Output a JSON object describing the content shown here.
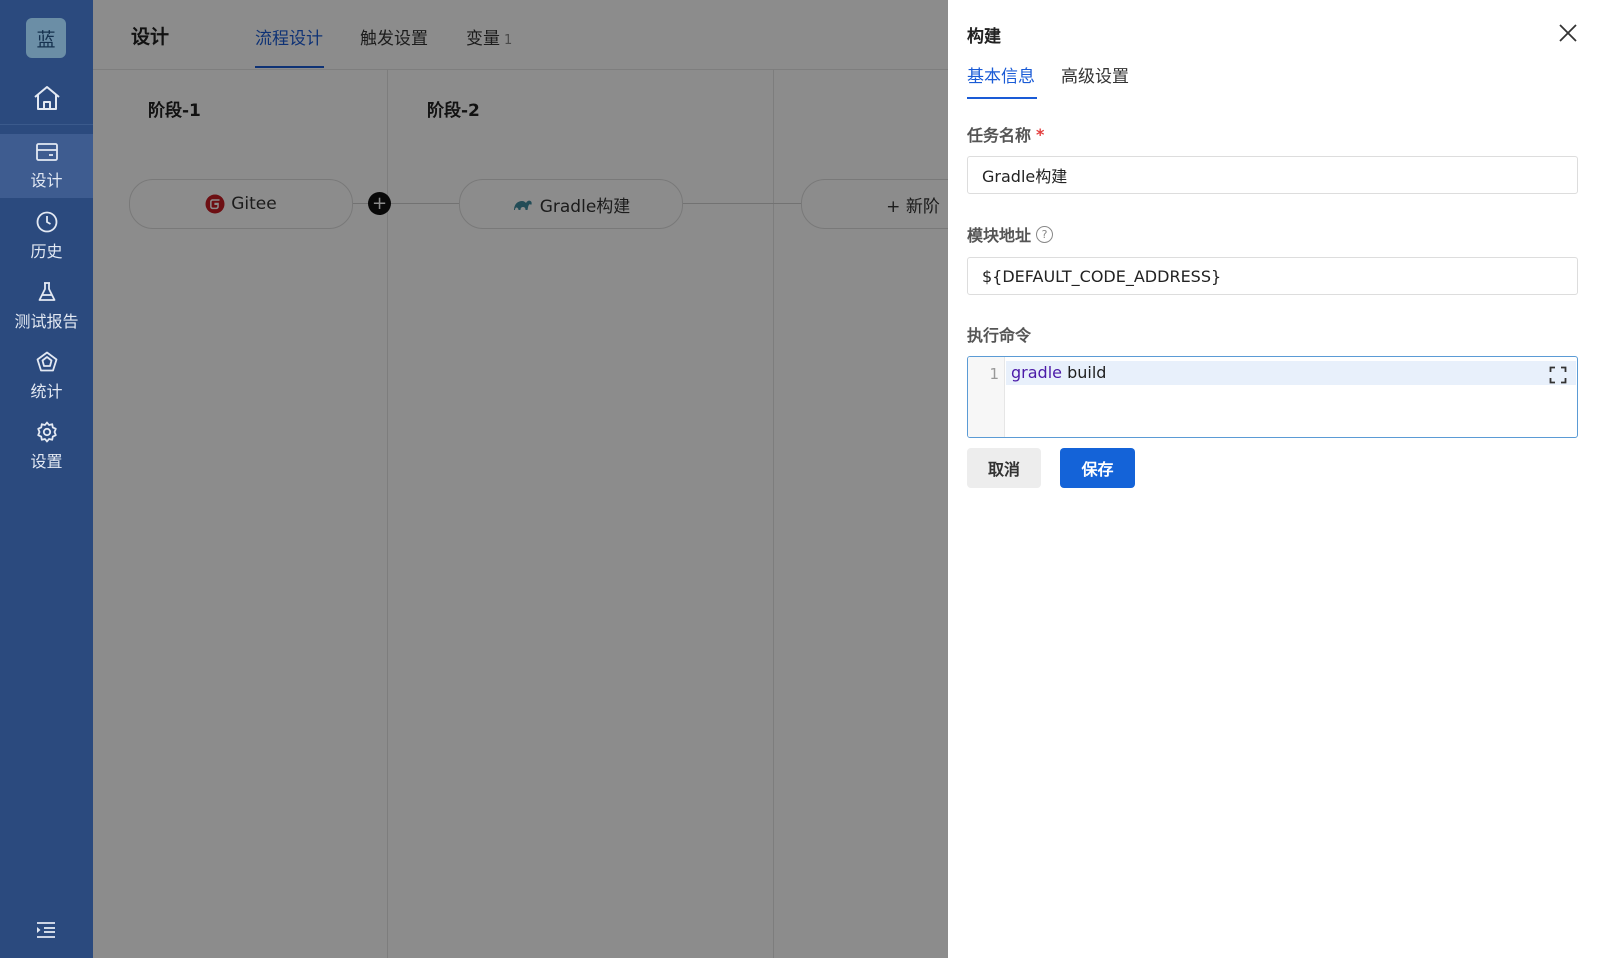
{
  "sidebar": {
    "logo_text": "蓝",
    "items": [
      {
        "label": "设计",
        "icon": "design-icon",
        "active": true
      },
      {
        "label": "历史",
        "icon": "clock-icon"
      },
      {
        "label": "测试报告",
        "icon": "flask-icon"
      },
      {
        "label": "统计",
        "icon": "pentagon-chart-icon"
      },
      {
        "label": "设置",
        "icon": "gear-icon"
      }
    ]
  },
  "header": {
    "title": "设计",
    "tabs": [
      {
        "label": "流程设计",
        "active": true
      },
      {
        "label": "触发设置"
      },
      {
        "label": "变量",
        "count": "1"
      }
    ]
  },
  "pipeline": {
    "stages": [
      {
        "title": "阶段-1",
        "node": "Gitee",
        "node_icon": "gitee-icon"
      },
      {
        "title": "阶段-2",
        "node": "Gradle构建",
        "node_icon": "gradle-icon"
      }
    ],
    "add_stage_label": "+ 新阶"
  },
  "drawer": {
    "title": "构建",
    "tabs": [
      {
        "label": "基本信息",
        "active": true
      },
      {
        "label": "高级设置"
      }
    ],
    "fields": {
      "task_name": {
        "label": "任务名称",
        "required_mark": "*",
        "value": "Gradle构建"
      },
      "module_address": {
        "label": "模块地址",
        "help": "?",
        "value": "${DEFAULT_CODE_ADDRESS}"
      },
      "command": {
        "label": "执行命令",
        "line_number": "1",
        "keyword": "gradle",
        "rest": " build"
      }
    },
    "buttons": {
      "cancel": "取消",
      "save": "保存"
    }
  },
  "colors": {
    "sidebar_bg": "#2b4a7e",
    "accent": "#1a5bd6",
    "primary_button": "#1463d8",
    "required": "#e23d3d"
  }
}
